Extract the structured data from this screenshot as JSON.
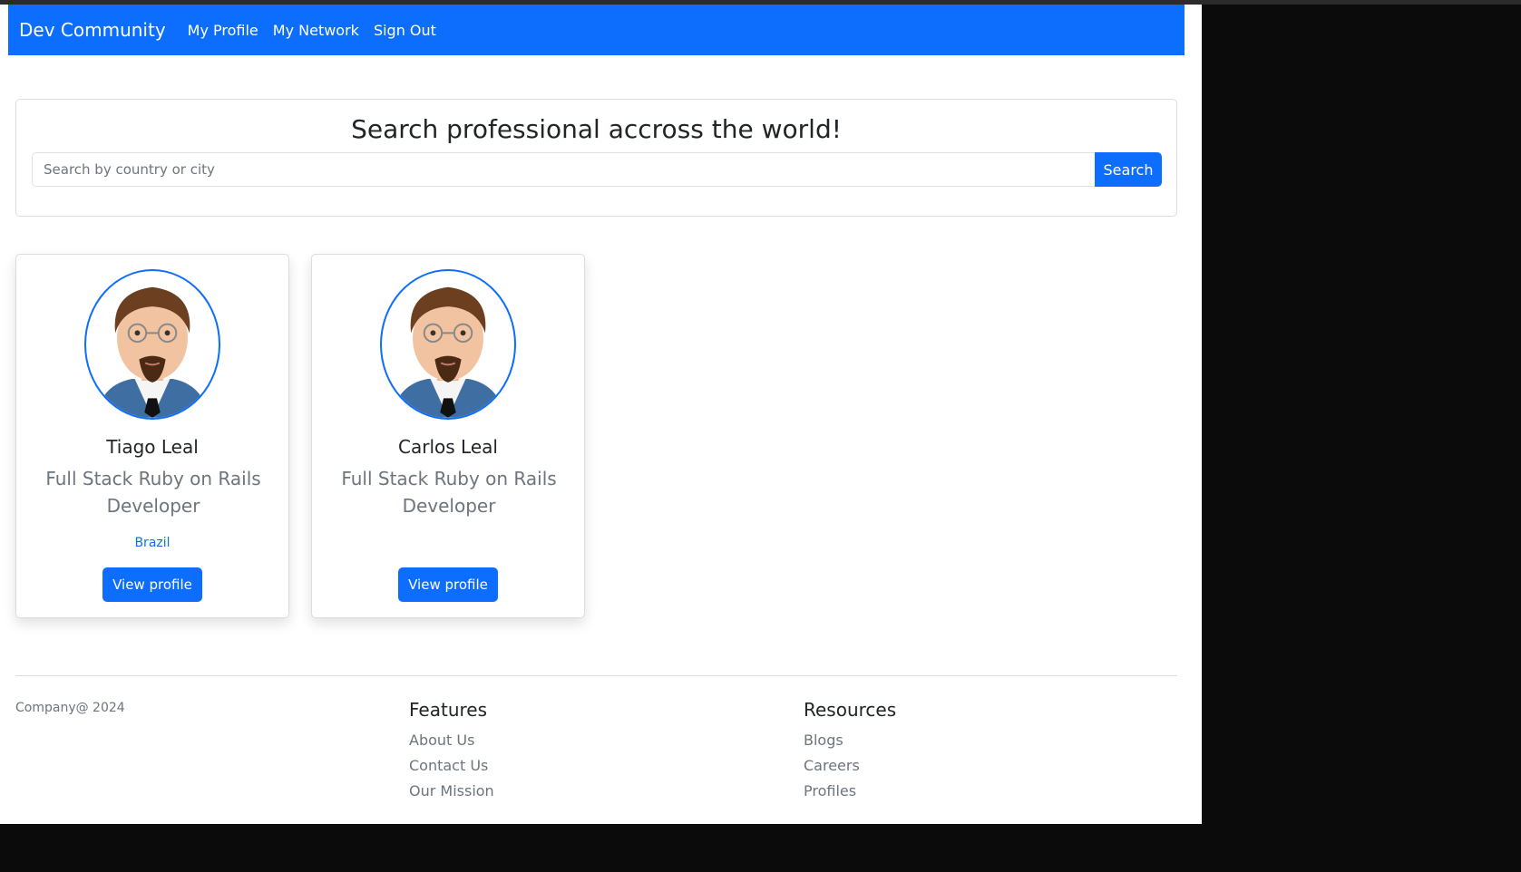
{
  "navbar": {
    "brand": "Dev Community",
    "links": [
      "My Profile",
      "My Network",
      "Sign Out"
    ]
  },
  "search": {
    "title": "Search professional accross the world!",
    "placeholder": "Search by country or city",
    "button_label": "Search"
  },
  "profiles": [
    {
      "name": "Tiago Leal",
      "title": "Full Stack Ruby on Rails Developer",
      "location": "Brazil",
      "button_label": "View profile"
    },
    {
      "name": "Carlos Leal",
      "title": "Full Stack Ruby on Rails Developer",
      "location": "",
      "button_label": "View profile"
    }
  ],
  "footer": {
    "copyright": "Company@ 2024",
    "features": {
      "heading": "Features",
      "links": [
        "About Us",
        "Contact Us",
        "Our Mission"
      ]
    },
    "resources": {
      "heading": "Resources",
      "links": [
        "Blogs",
        "Careers",
        "Profiles"
      ]
    }
  },
  "colors": {
    "primary": "#0d6efd",
    "muted": "#6c757d",
    "text": "#212529"
  }
}
